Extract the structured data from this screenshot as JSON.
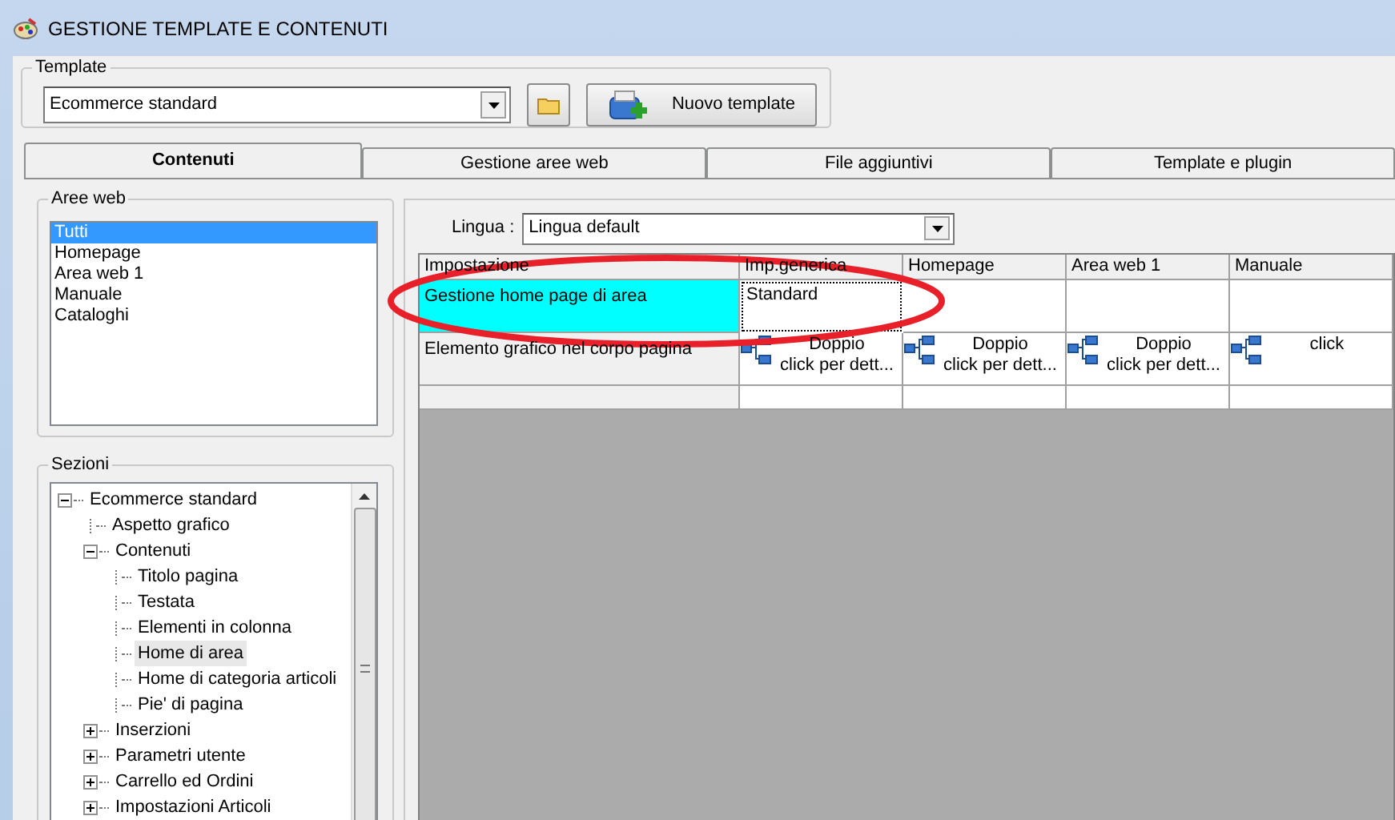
{
  "window": {
    "title": "GESTIONE TEMPLATE E CONTENUTI"
  },
  "template": {
    "label": "Template",
    "value": "Ecommerce standard",
    "new_button": "Nuovo template"
  },
  "tabs": [
    {
      "label": "Contenuti",
      "selected": true
    },
    {
      "label": "Gestione aree web",
      "selected": false
    },
    {
      "label": "File aggiuntivi",
      "selected": false
    },
    {
      "label": "Template e plugin",
      "selected": false
    }
  ],
  "aree_web": {
    "label": "Aree web",
    "items": [
      {
        "label": "Tutti",
        "selected": true
      },
      {
        "label": "Homepage",
        "selected": false
      },
      {
        "label": "Area web 1",
        "selected": false
      },
      {
        "label": "Manuale",
        "selected": false
      },
      {
        "label": "Cataloghi",
        "selected": false
      }
    ]
  },
  "sezioni": {
    "label": "Sezioni",
    "tree": [
      {
        "label": "Ecommerce standard",
        "expanded": true,
        "selected": false,
        "children": [
          {
            "label": "Aspetto grafico",
            "selected": false
          },
          {
            "label": "Contenuti",
            "expanded": true,
            "selected": false,
            "children": [
              {
                "label": "Titolo pagina",
                "selected": false
              },
              {
                "label": "Testata",
                "selected": false
              },
              {
                "label": "Elementi in colonna",
                "selected": false
              },
              {
                "label": "Home di area",
                "selected": true
              },
              {
                "label": "Home di categoria articoli",
                "selected": false
              },
              {
                "label": "Pie' di pagina",
                "selected": false
              }
            ]
          },
          {
            "label": "Inserzioni",
            "expanded": false,
            "selected": false
          },
          {
            "label": "Parametri utente",
            "expanded": false,
            "selected": false
          },
          {
            "label": "Carrello ed Ordini",
            "expanded": false,
            "selected": false
          },
          {
            "label": "Impostazioni Articoli",
            "expanded": false,
            "selected": false
          }
        ]
      }
    ]
  },
  "lingua": {
    "label": "Lingua :",
    "value": "Lingua default"
  },
  "grid": {
    "columns": [
      "Impostazione",
      "Imp.generica",
      "Homepage",
      "Area web 1",
      "Manuale"
    ],
    "rows": [
      {
        "cells": [
          {
            "kind": "label",
            "text": "Gestione home page di area",
            "selected": true
          },
          {
            "kind": "text",
            "text": "Standard",
            "focused": true
          },
          {
            "kind": "empty"
          },
          {
            "kind": "empty"
          },
          {
            "kind": "empty"
          }
        ]
      },
      {
        "cells": [
          {
            "kind": "label",
            "text": "Elemento grafico nel corpo pagina",
            "selected": false
          },
          {
            "kind": "detail",
            "lines": [
              "Doppio",
              "click per dett..."
            ]
          },
          {
            "kind": "detail",
            "lines": [
              "Doppio",
              "click per dett..."
            ]
          },
          {
            "kind": "detail",
            "lines": [
              "Doppio",
              "click per dett..."
            ]
          },
          {
            "kind": "detail",
            "lines": [
              "click"
            ]
          }
        ]
      },
      {
        "cells": [
          {
            "kind": "empty"
          },
          {
            "kind": "empty"
          },
          {
            "kind": "empty"
          },
          {
            "kind": "empty"
          },
          {
            "kind": "empty"
          }
        ]
      }
    ]
  },
  "annotation": {
    "kind": "ellipse"
  }
}
